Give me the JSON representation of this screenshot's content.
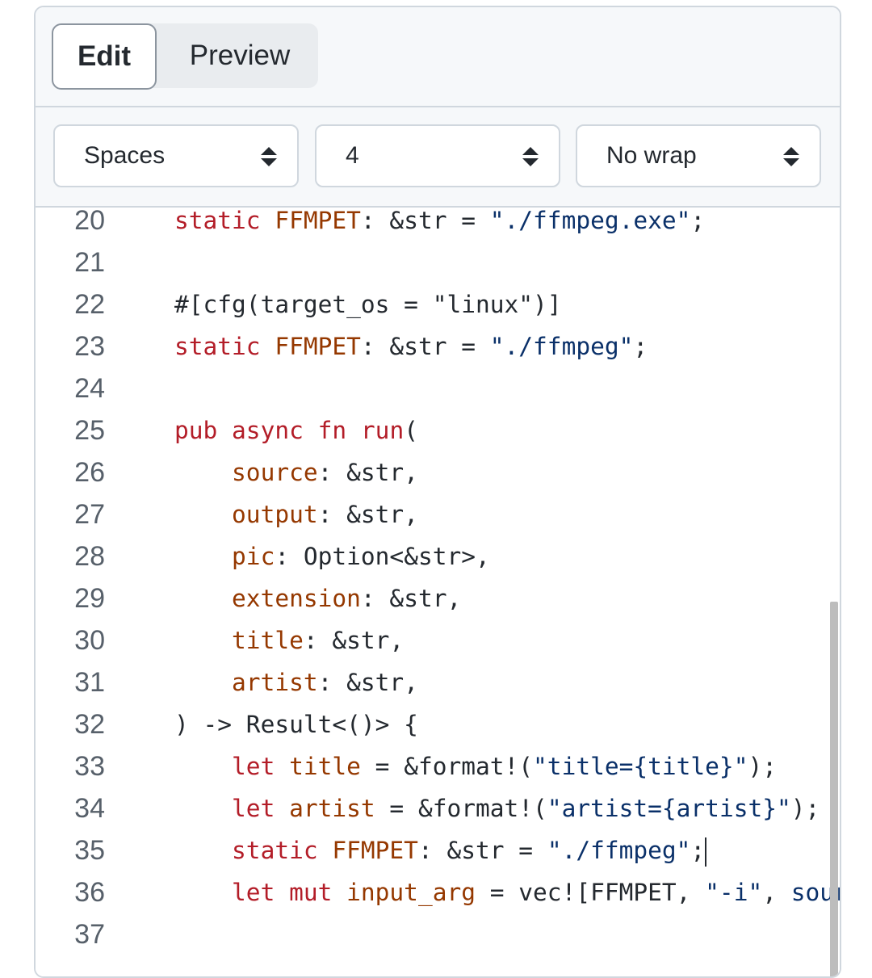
{
  "tabs": {
    "edit": "Edit",
    "preview": "Preview"
  },
  "toolbar": {
    "indent_mode": "Spaces",
    "indent_size": "4",
    "wrap_mode": "No wrap"
  },
  "editor": {
    "lines": [
      {
        "n": "20",
        "tokens": [
          [
            "k",
            "static "
          ],
          [
            "f",
            "FFMPET"
          ],
          [
            "p",
            ": &str = "
          ],
          [
            "s",
            "\"./ffmpeg.exe\""
          ],
          [
            "p",
            ";"
          ]
        ]
      },
      {
        "n": "21",
        "tokens": []
      },
      {
        "n": "22",
        "tokens": [
          [
            "p",
            "#[cfg(target_os = \"linux\")]"
          ]
        ]
      },
      {
        "n": "23",
        "tokens": [
          [
            "k",
            "static "
          ],
          [
            "f",
            "FFMPET"
          ],
          [
            "p",
            ": &str = "
          ],
          [
            "s",
            "\"./ffmpeg\""
          ],
          [
            "p",
            ";"
          ]
        ]
      },
      {
        "n": "24",
        "tokens": []
      },
      {
        "n": "25",
        "tokens": [
          [
            "k",
            "pub "
          ],
          [
            "k",
            "async "
          ],
          [
            "k",
            "fn "
          ],
          [
            "k",
            "run"
          ],
          [
            "p",
            "("
          ]
        ]
      },
      {
        "n": "26",
        "tokens": [
          [
            "p",
            "    "
          ],
          [
            "f",
            "source"
          ],
          [
            "p",
            ": &str,"
          ]
        ]
      },
      {
        "n": "27",
        "tokens": [
          [
            "p",
            "    "
          ],
          [
            "f",
            "output"
          ],
          [
            "p",
            ": &str,"
          ]
        ]
      },
      {
        "n": "28",
        "tokens": [
          [
            "p",
            "    "
          ],
          [
            "f",
            "pic"
          ],
          [
            "p",
            ": Option<&str>,"
          ]
        ]
      },
      {
        "n": "29",
        "tokens": [
          [
            "p",
            "    "
          ],
          [
            "f",
            "extension"
          ],
          [
            "p",
            ": &str,"
          ]
        ]
      },
      {
        "n": "30",
        "tokens": [
          [
            "p",
            "    "
          ],
          [
            "f",
            "title"
          ],
          [
            "p",
            ": &str,"
          ]
        ]
      },
      {
        "n": "31",
        "tokens": [
          [
            "p",
            "    "
          ],
          [
            "f",
            "artist"
          ],
          [
            "p",
            ": &str,"
          ]
        ]
      },
      {
        "n": "32",
        "tokens": [
          [
            "p",
            ") -> Result<()> {"
          ]
        ]
      },
      {
        "n": "33",
        "tokens": [
          [
            "p",
            "    "
          ],
          [
            "k",
            "let "
          ],
          [
            "f",
            "title"
          ],
          [
            "p",
            " = &format!("
          ],
          [
            "s",
            "\"title={title}\""
          ],
          [
            "p",
            ");"
          ]
        ]
      },
      {
        "n": "34",
        "tokens": [
          [
            "p",
            "    "
          ],
          [
            "k",
            "let "
          ],
          [
            "f",
            "artist"
          ],
          [
            "p",
            " = &format!("
          ],
          [
            "s",
            "\"artist={artist}\""
          ],
          [
            "p",
            ");"
          ]
        ]
      },
      {
        "n": "35",
        "tokens": [
          [
            "p",
            "    "
          ],
          [
            "k",
            "static "
          ],
          [
            "f",
            "FFMPET"
          ],
          [
            "p",
            ": &str = "
          ],
          [
            "s",
            "\"./ffmpeg\""
          ],
          [
            "p",
            ";"
          ]
        ],
        "cursor": true
      },
      {
        "n": "36",
        "tokens": [
          [
            "p",
            "    "
          ],
          [
            "k",
            "let "
          ],
          [
            "k",
            "mut "
          ],
          [
            "f",
            "input_arg"
          ],
          [
            "p",
            " = vec![FFMPET, "
          ],
          [
            "s",
            "\"-i\""
          ],
          [
            "p",
            ", "
          ],
          [
            "s",
            "source"
          ]
        ]
      },
      {
        "n": "37",
        "tokens": []
      }
    ]
  },
  "colors": {
    "keyword": "#b31d28",
    "field": "#953800",
    "string": "#0a3069",
    "text": "#24292f",
    "gutter": "#57606a",
    "border": "#d0d7de",
    "header_bg": "#f6f8fa"
  }
}
